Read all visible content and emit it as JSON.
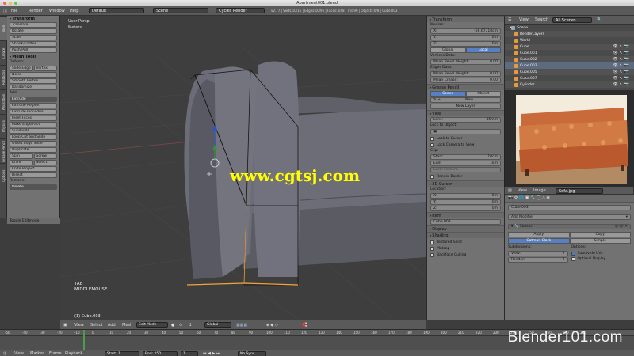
{
  "window": {
    "title": "Apartment001.blend"
  },
  "topbar": {
    "menus": [
      "File",
      "Render",
      "Window",
      "Help"
    ],
    "layout": "Default",
    "scene": "Scene",
    "engine": "Cycles Render",
    "stats": "v2.77 | Verts:10/16 | Edges:10/96 | Faces:4/48 | Tris:96 | Objects:0/8 | Cube.003"
  },
  "tabs": [
    "Tools",
    "Create",
    "Relations",
    "Animation",
    "Physics",
    "Grease Pencil",
    "Options"
  ],
  "tool_shelf": {
    "transform_title": "Transform",
    "transform_buttons": [
      "Translate",
      "Rotate",
      "Scale",
      "Shrink/Flatten",
      "Push/Pull"
    ],
    "mesh_tools_title": "Mesh Tools",
    "deform_label": "Deform:",
    "deform_row": [
      "Slide Edge",
      "Vertex"
    ],
    "deform_buttons": [
      "Noise",
      "Smooth Vertex",
      "Randomize"
    ],
    "add_label": "Add:",
    "extrude_dropdown": "Extrude",
    "add_buttons": [
      "Extrude Region",
      "Extrude Individual",
      "Inset Faces",
      "Make Edge/Face",
      "Subdivide",
      "Loop Cut and Slide",
      "Offset Edge Slide",
      "Duplicate"
    ],
    "spin_row": [
      "Spin",
      "Screw"
    ],
    "knife_row": [
      "Knife",
      "Select"
    ],
    "more_buttons": [
      "Knife Project",
      "Bisect"
    ],
    "remove_label": "Remove:",
    "delete_dropdown": "Delete",
    "toggle_editmode": "Toggle Editmode"
  },
  "viewport": {
    "view_name": "User Persp",
    "units": "Meters",
    "key_hint_1": "TAB",
    "key_hint_2": "MIDDLEMOUSE",
    "object_label": "(1) Cube.003",
    "watermark": "www.cgtsj.com"
  },
  "viewport_bar": {
    "items": [
      "View",
      "Select",
      "Add",
      "Mesh"
    ],
    "mode": "Edit Mode",
    "orientation": "Global"
  },
  "properties": {
    "transform_title": "Transform",
    "median_label": "Median:",
    "x": {
      "label": "X:",
      "value": "-66.67718cm"
    },
    "y": {
      "label": "Y:",
      "value": "0m"
    },
    "z": {
      "label": "Z:",
      "value": "0m"
    },
    "global_btn": "Global",
    "local_btn": "Local",
    "vertex_data": "Vertices Data:",
    "mean_bevel": {
      "label": "Mean Bevel Weight:",
      "value": "0.00"
    },
    "edges_data": "Edges Data:",
    "mean_bevel2": {
      "label": "Mean Bevel Weight:",
      "value": "0.00"
    },
    "mean_crease": {
      "label": "Mean Crease:",
      "value": "0.00"
    },
    "grease_title": "Grease Pencil",
    "scene_btn": "Scene",
    "object_btn": "Object",
    "new_btn": "New",
    "new_layer_btn": "New Layer",
    "view_title": "View",
    "lens": {
      "label": "Lens:",
      "value": "35mm"
    },
    "lock_object": "Lock to Object:",
    "lock_cursor": "Lock to Cursor",
    "lock_camera": "Lock Camera to View",
    "clip_label": "Clip:",
    "clip_start": {
      "label": "Start:",
      "value": "10cm"
    },
    "clip_end": {
      "label": "End:",
      "value": "1km"
    },
    "local_camera": "Local Camera",
    "render_border": "Render Border",
    "cursor_title": "3D Cursor",
    "location_label": "Location:",
    "cx": {
      "label": "X:",
      "value": "0m"
    },
    "cy": {
      "label": "Y:",
      "value": "0m"
    },
    "cz": {
      "label": "Z:",
      "value": "0m"
    },
    "item_title": "Item",
    "item_name": "Cube.003",
    "display_title": "Display",
    "shading_title": "Shading",
    "textured_solid": "Textured Solid",
    "matcap": "Matcap",
    "backface": "Backface Culling"
  },
  "outliner": {
    "menus": [
      "View",
      "Search"
    ],
    "filter": "All Scenes",
    "items": [
      {
        "name": "Scene"
      },
      {
        "name": "RenderLayers"
      },
      {
        "name": "World"
      },
      {
        "name": "Cube"
      },
      {
        "name": "Cube.001"
      },
      {
        "name": "Cube.002"
      },
      {
        "name": "Cube.003"
      },
      {
        "name": "Cube.005"
      },
      {
        "name": "Cube.007"
      },
      {
        "name": "Cylinder"
      }
    ]
  },
  "image_editor": {
    "menus": [
      "View",
      "Image"
    ],
    "image_name": "Sofa.jpg"
  },
  "modifiers": {
    "object_name": "Cube.003",
    "add_modifier": "Add Modifier",
    "modifier_name": "Subsurf",
    "apply_btn": "Apply",
    "copy_btn": "Copy",
    "catmull": "Catmull-Clark",
    "simple": "Simple",
    "subdivisions_label": "Subdivisions:",
    "view_field": {
      "label": "View:",
      "value": "2"
    },
    "render_field": {
      "label": "Render:",
      "value": "2"
    },
    "options_label": "Options:",
    "subdivide_uvs": "Subdivide UVs",
    "optimal_display": "Optimal Display"
  },
  "timeline": {
    "ticks": [
      "-50",
      "-40",
      "-30",
      "-20",
      "-10",
      "0",
      "10",
      "20",
      "30",
      "40",
      "50",
      "60",
      "70",
      "80",
      "90",
      "100",
      "110",
      "120",
      "130",
      "140",
      "150",
      "160",
      "170",
      "180",
      "190",
      "200",
      "210",
      "220",
      "230",
      "240",
      "250",
      "260",
      "270",
      "280"
    ],
    "menus": [
      "View",
      "Marker",
      "Frame",
      "Playback"
    ],
    "start": {
      "label": "Start:",
      "value": "1"
    },
    "end": {
      "label": "End:",
      "value": "250"
    },
    "current": "1",
    "sync": "No Sync"
  },
  "brand": "Blender101.com"
}
